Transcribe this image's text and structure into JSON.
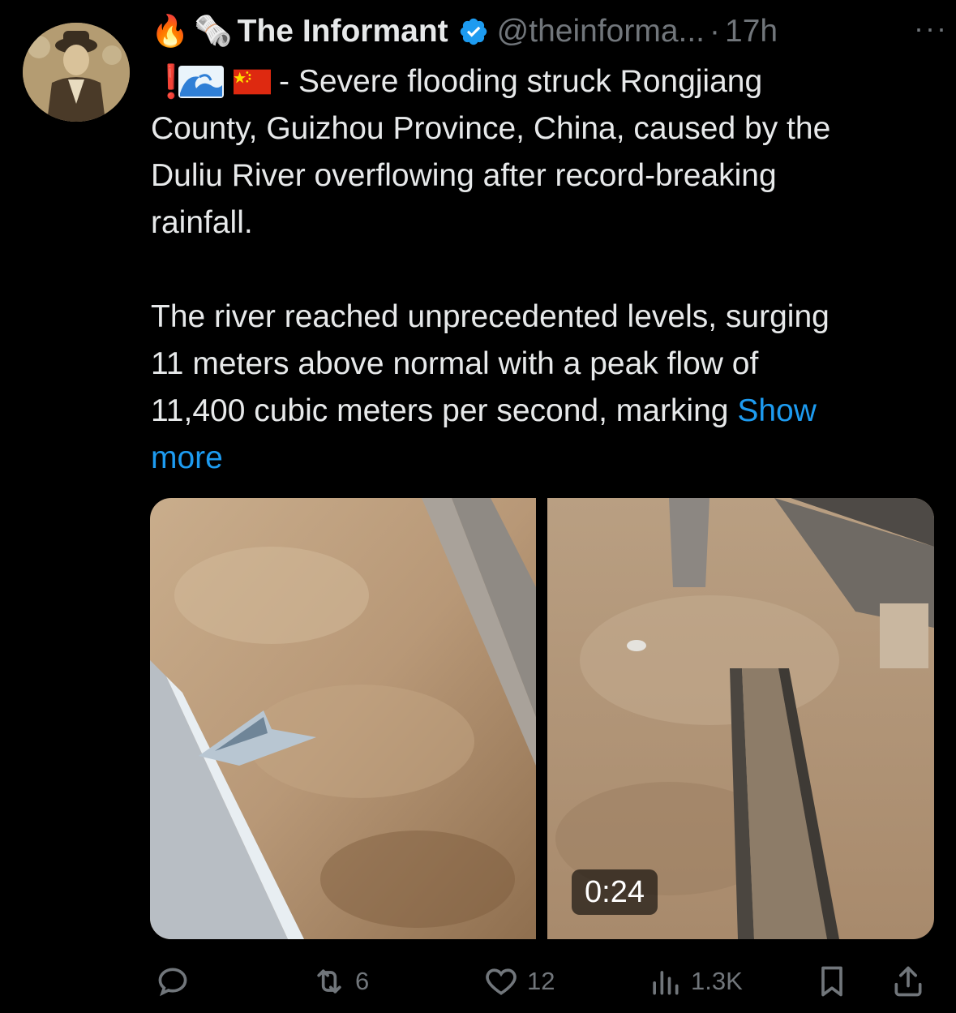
{
  "tweet": {
    "emojis_prefix": [
      "🔥",
      "🗞️"
    ],
    "author_name": "The Informant",
    "handle": "@theinforma...",
    "separator": "·",
    "time": "17h",
    "more_label": "···",
    "line1_emojis": [
      "❗",
      "🌊",
      "🇨🇳"
    ],
    "text_paragraph1_first": "- Severe flooding struck Rongjiang",
    "text_paragraph1_rest": "County, Guizhou Province, China, caused by the\nDuliu River overflowing after record-breaking\nrainfall.",
    "text_paragraph2": "The river reached unprecedented levels, surging\n11 meters above normal with a peak flow of\n11,400 cubic meters per second, marking ",
    "show_more": "Show\nmore"
  },
  "media": {
    "video_duration": "0:24"
  },
  "actions": {
    "reply_count": "",
    "retweet_count": "6",
    "like_count": "12",
    "views_count": "1.3K"
  },
  "colors": {
    "background": "#000000",
    "text": "#e7e9ea",
    "muted": "#71767b",
    "link": "#1d9bf0",
    "verified": "#1d9bf0"
  }
}
